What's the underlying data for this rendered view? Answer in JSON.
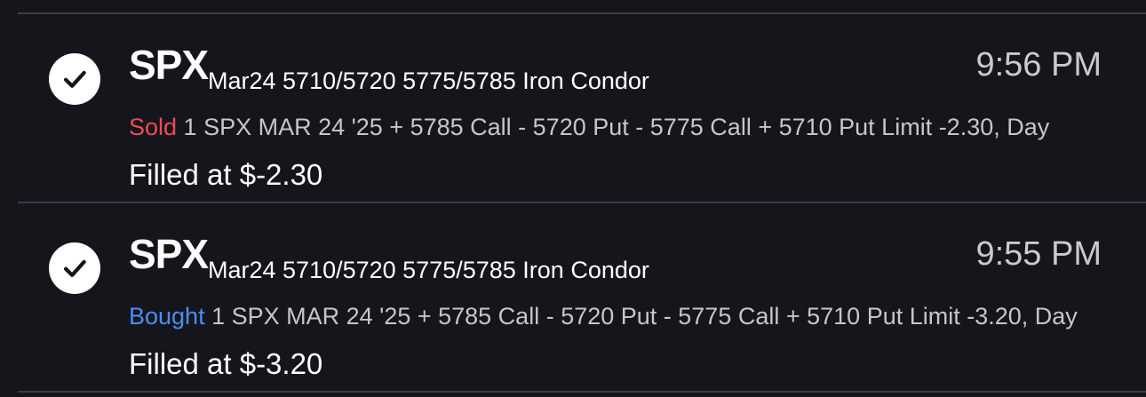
{
  "orders": [
    {
      "symbol": "SPX",
      "description": "Mar24 5710/5720 5775/5785 Iron Condor",
      "time": "9:56 PM",
      "action": "Sold",
      "detail": " 1 SPX MAR 24 '25 + 5785 Call - 5720 Put - 5775 Call + 5710 Put Limit -2.30, Day",
      "fill": "Filled at $-2.30",
      "action_color": "#f04a55"
    },
    {
      "symbol": "SPX",
      "description": "Mar24 5710/5720 5775/5785 Iron Condor",
      "time": "9:55 PM",
      "action": "Bought",
      "detail": " 1 SPX MAR 24 '25 + 5785 Call - 5720 Put - 5775 Call + 5710 Put Limit -3.20, Day",
      "fill": "Filled at $-3.20",
      "action_color": "#4a8ef0"
    }
  ],
  "icons": {
    "status": "check-circle-icon"
  }
}
